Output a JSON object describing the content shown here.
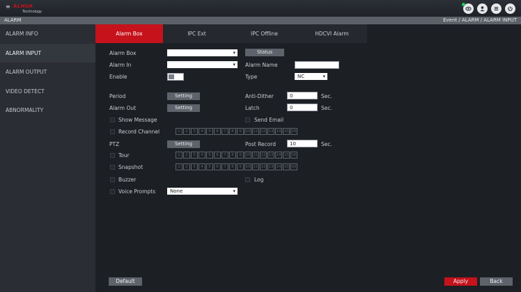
{
  "header": {
    "logo_brand": "ALHUA",
    "logo_sub": "Technology"
  },
  "crumb": {
    "title": "ALARM",
    "path": "Event  /  ALARM  /  ALARM INPUT"
  },
  "sidebar": {
    "items": [
      {
        "label": "ALARM INFO"
      },
      {
        "label": "ALARM INPUT"
      },
      {
        "label": "ALARM OUTPUT"
      },
      {
        "label": "VIDEO DETECT"
      },
      {
        "label": "ABNORMALITY"
      }
    ]
  },
  "tabs": [
    {
      "label": "Alarm Box"
    },
    {
      "label": "IPC Ext"
    },
    {
      "label": "IPC Offline"
    },
    {
      "label": "HDCVI Alarm"
    }
  ],
  "form": {
    "alarm_box_label": "Alarm Box",
    "alarm_box_value": "",
    "status_button": "Status",
    "alarm_in_label": "Alarm In",
    "alarm_in_value": "",
    "alarm_name_label": "Alarm Name",
    "alarm_name_value": "",
    "enable_label": "Enable",
    "type_label": "Type",
    "type_value": "NC",
    "period_label": "Period",
    "period_setting": "Setting",
    "anti_dither_label": "Anti-Dither",
    "anti_dither_value": "0",
    "anti_dither_unit": "Sec.",
    "alarm_out_label": "Alarm Out",
    "alarm_out_setting": "Setting",
    "latch_label": "Latch",
    "latch_value": "0",
    "latch_unit": "Sec.",
    "show_message_label": "Show Message",
    "send_email_label": "Send Email",
    "record_channel_label": "Record Channel",
    "ptz_label": "PTZ",
    "ptz_setting": "Setting",
    "post_record_label": "Post Record",
    "post_record_value": "10",
    "post_record_unit": "Sec.",
    "tour_label": "Tour",
    "snapshot_label": "Snapshot",
    "buzzer_label": "Buzzer",
    "log_label": "Log",
    "voice_prompts_label": "Voice Prompts",
    "voice_prompts_value": "None",
    "channels": [
      "1",
      "2",
      "3",
      "4",
      "5",
      "6",
      "7",
      "8",
      "9",
      "10",
      "11",
      "12",
      "13",
      "14",
      "15",
      "16"
    ]
  },
  "footer": {
    "default_button": "Default",
    "apply_button": "Apply",
    "back_button": "Back"
  },
  "colors": {
    "accent": "#c5121b",
    "status_online": "#22c55e"
  },
  "icons": [
    "preview-icon",
    "user-icon",
    "menu-icon",
    "power-icon"
  ]
}
